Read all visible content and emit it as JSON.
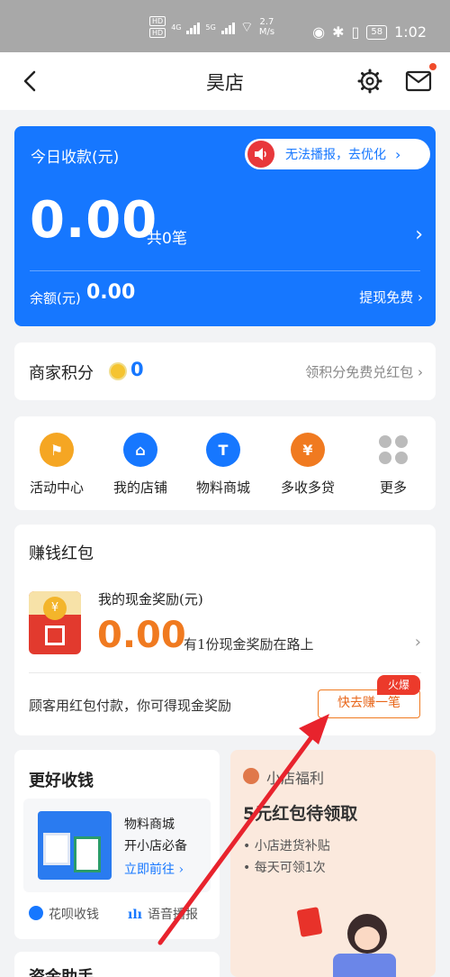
{
  "status_bar": {
    "hd1": "HD",
    "hd2": "HD",
    "net1": "4G",
    "net2": "5G",
    "speed_value": "2.7",
    "speed_unit": "M/s",
    "battery": "58",
    "time": "1:02"
  },
  "header": {
    "title": "昊店"
  },
  "revenue": {
    "label": "今日收款(元)",
    "voice_text": "无法播报，去优化",
    "amount": "0.00",
    "count": "共0笔",
    "balance_label": "余额(元)",
    "balance": "0.00",
    "withdraw": "提现免费"
  },
  "points": {
    "label": "商家积分",
    "value": "0",
    "action": "领积分免费兑红包"
  },
  "menu": [
    {
      "label": "活动中心",
      "color": "#f5a623",
      "icon": "flag-icon"
    },
    {
      "label": "我的店铺",
      "color": "#1677ff",
      "icon": "shop-icon"
    },
    {
      "label": "物料商城",
      "color": "#1677ff",
      "icon": "T"
    },
    {
      "label": "多收多贷",
      "color": "#f07a20",
      "icon": "loan-icon"
    },
    {
      "label": "更多",
      "color": "#aaaaaa",
      "icon": "more-icon"
    }
  ],
  "red_packet": {
    "title": "赚钱红包",
    "sub": "我的现金奖励(元)",
    "amount": "0.00",
    "on_way": "有1份现金奖励在路上",
    "desc": "顾客用红包付款，你可得现金奖励",
    "button": "快去赚一笔",
    "badge": "火爆"
  },
  "collect": {
    "title": "更好收钱",
    "line1": "物料商城",
    "line2": "开小店必备",
    "link": "立即前往",
    "huabei": "花呗收钱",
    "voice": "语音播报"
  },
  "welfare": {
    "title": "小店福利",
    "headline": "5元红包待领取",
    "line1": "• 小店进货补贴",
    "line2": "• 每天可领1次"
  },
  "funds": {
    "title": "资金助手"
  }
}
